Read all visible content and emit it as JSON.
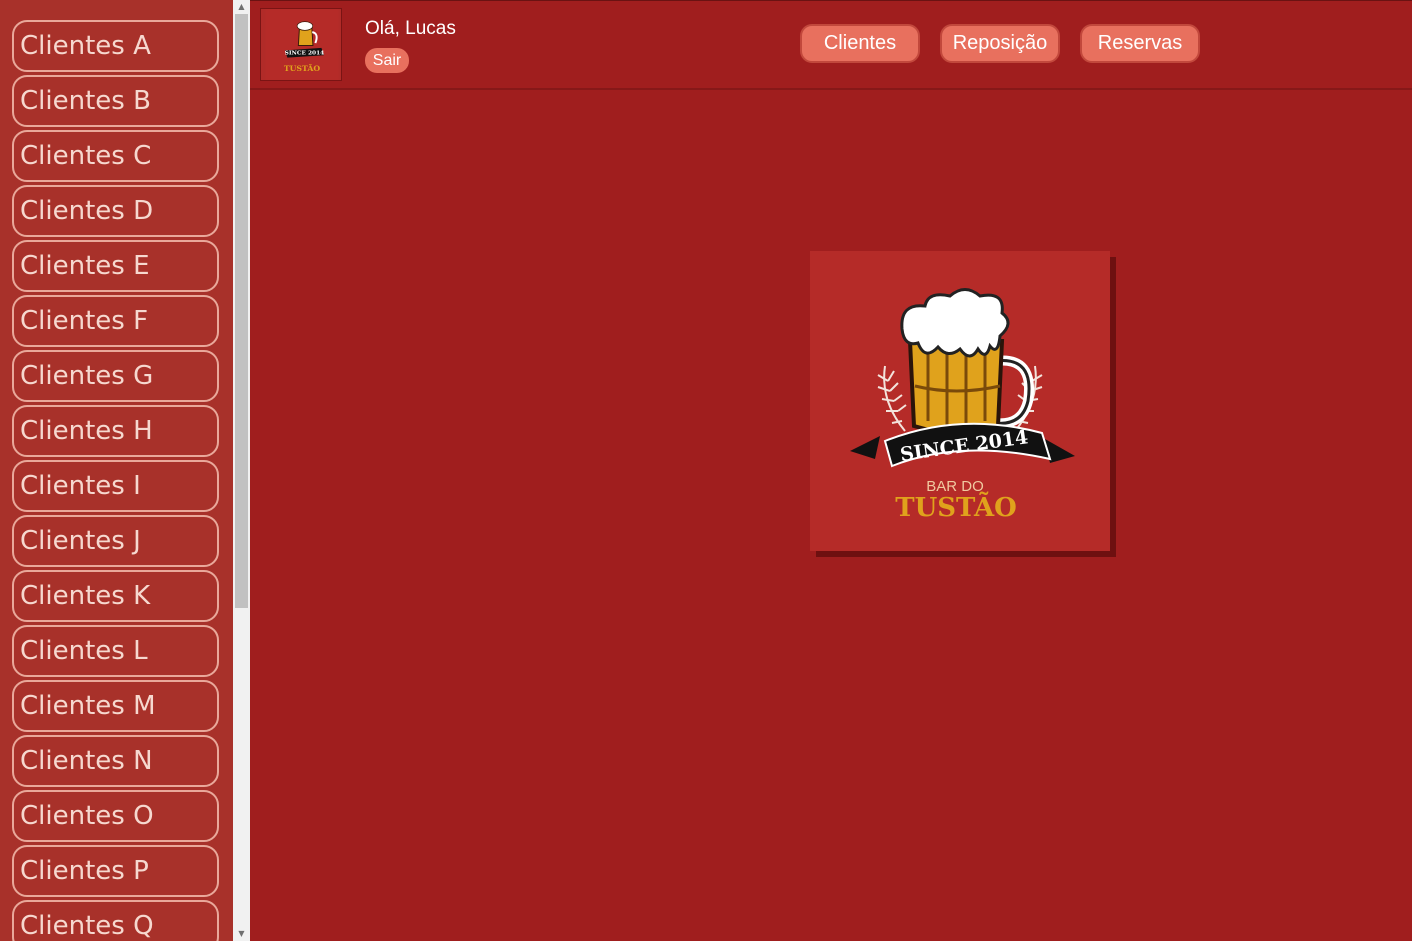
{
  "sidebar": {
    "items": [
      {
        "label": "Clientes A"
      },
      {
        "label": "Clientes B"
      },
      {
        "label": "Clientes C"
      },
      {
        "label": "Clientes D"
      },
      {
        "label": "Clientes E"
      },
      {
        "label": "Clientes F"
      },
      {
        "label": "Clientes G"
      },
      {
        "label": "Clientes H"
      },
      {
        "label": "Clientes I"
      },
      {
        "label": "Clientes J"
      },
      {
        "label": "Clientes K"
      },
      {
        "label": "Clientes L"
      },
      {
        "label": "Clientes M"
      },
      {
        "label": "Clientes N"
      },
      {
        "label": "Clientes O"
      },
      {
        "label": "Clientes P"
      },
      {
        "label": "Clientes Q"
      }
    ]
  },
  "header": {
    "greeting": "Olá, Lucas",
    "logout_label": "Sair",
    "nav": [
      {
        "label": "Clientes"
      },
      {
        "label": "Reposição"
      },
      {
        "label": "Reservas"
      }
    ]
  },
  "logo": {
    "since_text": "SINCE 2014",
    "bar_do": "BAR DO",
    "name": "TUSTÃO",
    "thumb_since_text": "SINCE 2014",
    "thumb_name": "TUSTÃO"
  },
  "colors": {
    "background": "#a01e1e",
    "sidebar": "#a8312a",
    "button": "#e8705e",
    "logo_gold": "#e0a21c"
  }
}
